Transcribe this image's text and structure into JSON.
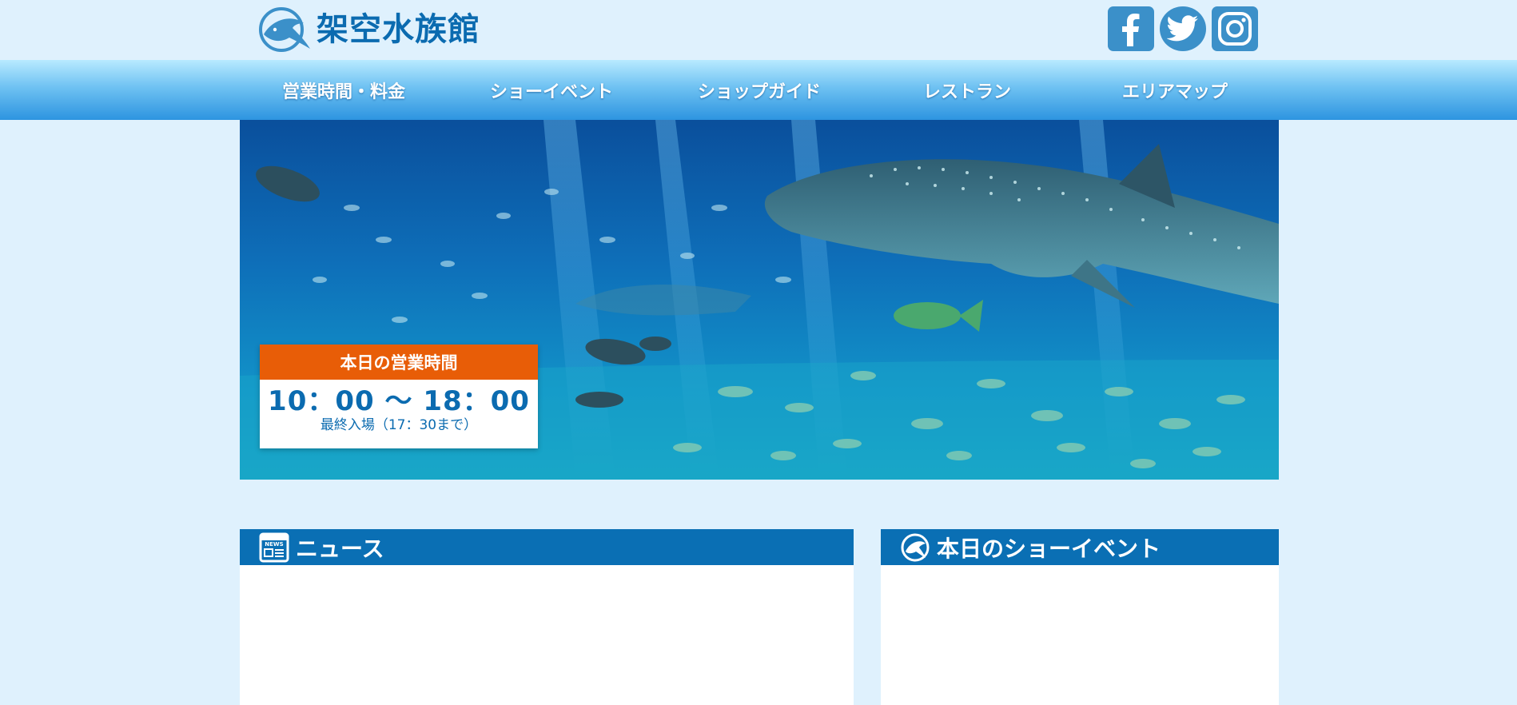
{
  "header": {
    "logo_text": "架空水族館",
    "logo_icon": "dolphin-icon",
    "social": [
      {
        "name": "facebook",
        "icon": "facebook-icon"
      },
      {
        "name": "twitter",
        "icon": "twitter-icon"
      },
      {
        "name": "instagram",
        "icon": "instagram-icon"
      }
    ]
  },
  "nav": {
    "items": [
      {
        "label": "営業時間・料金"
      },
      {
        "label": "ショーイベント"
      },
      {
        "label": "ショップガイド"
      },
      {
        "label": "レストラン"
      },
      {
        "label": "エリアマップ"
      }
    ]
  },
  "hero": {
    "image": "whale-shark-aquarium-photo",
    "hours": {
      "title": "本日の営業時間",
      "time": "10：00 〜 18：00",
      "note": "最終入場（17：30まで）"
    }
  },
  "news": {
    "title": "ニュース",
    "icon": "news-icon"
  },
  "shows": {
    "title": "本日のショーイベント",
    "icon": "dolphin-circle-icon"
  },
  "colors": {
    "page_bg": "#dff1fd",
    "brand_blue": "#0b6bb0",
    "accent_orange": "#e85d07",
    "panel_header": "#0a6fb4"
  }
}
